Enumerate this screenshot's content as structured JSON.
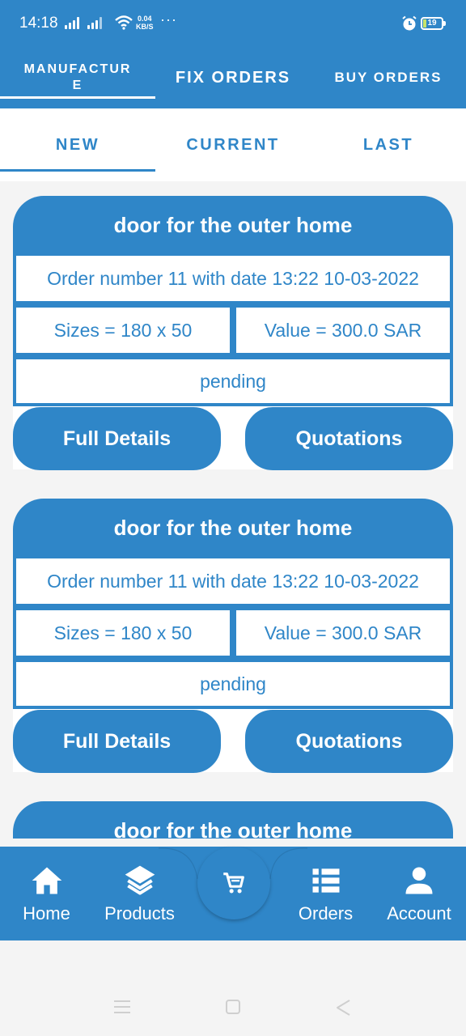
{
  "status_bar": {
    "time": "14:18",
    "net_speed_value": "0.04",
    "net_speed_unit": "KB/S",
    "more": "···",
    "battery": "19"
  },
  "top_tabs": [
    {
      "label": "MANUFACTUR E",
      "active": true
    },
    {
      "label": "FIX ORDERS",
      "active": false
    },
    {
      "label": "BUY ORDERS",
      "active": false
    }
  ],
  "sub_tabs": [
    {
      "label": "NEW",
      "active": true
    },
    {
      "label": "CURRENT",
      "active": false
    },
    {
      "label": "LAST",
      "active": false
    }
  ],
  "orders": [
    {
      "title": "door for the outer home",
      "order_info": "Order number 11 with date 13:22 10-03-2022",
      "sizes": "Sizes = 180 x 50",
      "value": "Value = 300.0 SAR",
      "status": "pending",
      "details_label": "Full Details",
      "quotations_label": "Quotations"
    },
    {
      "title": "door for the outer home",
      "order_info": "Order number 11 with date 13:22 10-03-2022",
      "sizes": "Sizes = 180 x 50",
      "value": "Value = 300.0 SAR",
      "status": "pending",
      "details_label": "Full Details",
      "quotations_label": "Quotations"
    },
    {
      "title": "door for the outer home"
    }
  ],
  "bottom_nav": [
    {
      "label": "Home",
      "icon": "home-icon"
    },
    {
      "label": "Products",
      "icon": "layers-icon"
    },
    {
      "label": "",
      "icon": "cart-icon"
    },
    {
      "label": "Orders",
      "icon": "list-icon"
    },
    {
      "label": "Account",
      "icon": "account-icon"
    }
  ],
  "colors": {
    "primary": "#2f86c8",
    "background": "#f4f4f4",
    "card_row": "#ffffff"
  }
}
